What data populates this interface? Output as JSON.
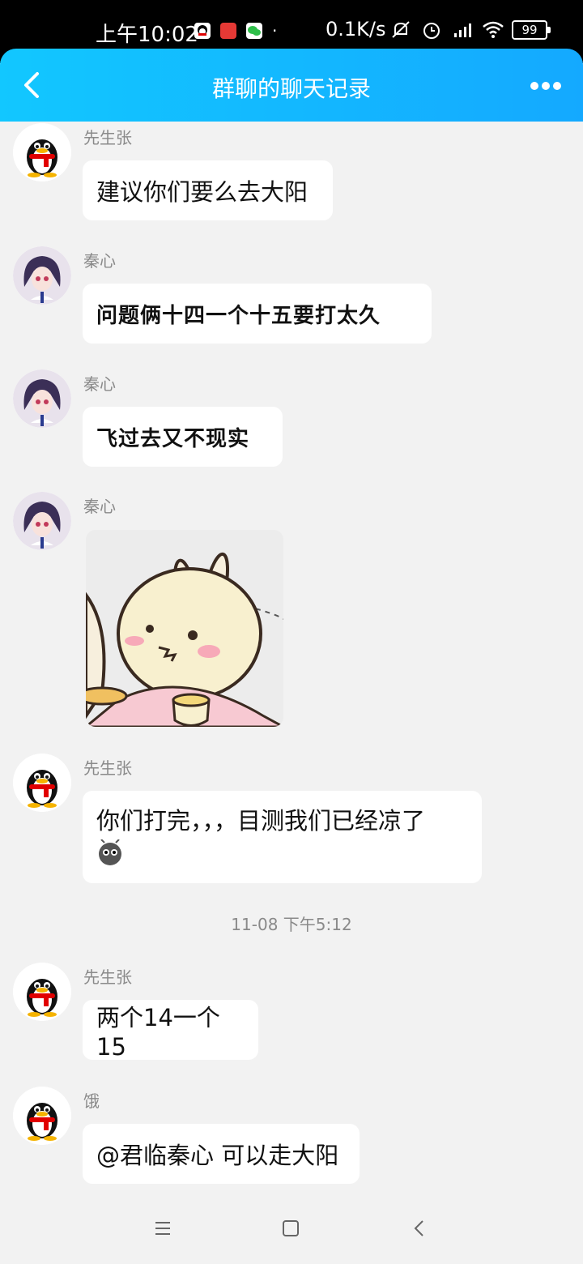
{
  "status_bar": {
    "time": "上午10:02",
    "net_speed": "0.1K/s",
    "battery": "99"
  },
  "header": {
    "title": "群聊的聊天记录"
  },
  "messages": [
    {
      "sender": "先生张",
      "text": "建议你们要么去大阳",
      "avatar": "qq-penguin-avatar"
    },
    {
      "sender": "秦心",
      "text": "问题俩十四一个十五要打太久",
      "avatar": "anime-girl-avatar"
    },
    {
      "sender": "秦心",
      "text": "飞过去又不现实",
      "avatar": "anime-girl-avatar"
    },
    {
      "sender": "秦心",
      "text": "",
      "avatar": "anime-girl-avatar",
      "sticker": "bunny-tea-sticker"
    },
    {
      "sender": "先生张",
      "text": "你们打完，，，目测我们已经凉了",
      "avatar": "qq-penguin-avatar",
      "emoji": "bug-emoji"
    }
  ],
  "divider": "11-08 下午5:12",
  "messages_after": [
    {
      "sender": "先生张",
      "text": "两个14一个15",
      "avatar": "qq-penguin-avatar"
    },
    {
      "sender": "饿",
      "text": "@君临秦心 可以走大阳",
      "avatar": "qq-penguin-avatar"
    }
  ],
  "colors": {
    "header_gradient_start": "#12c7ff",
    "header_gradient_end": "#14a9ff",
    "background": "#f2f2f2",
    "bubble": "#ffffff"
  }
}
